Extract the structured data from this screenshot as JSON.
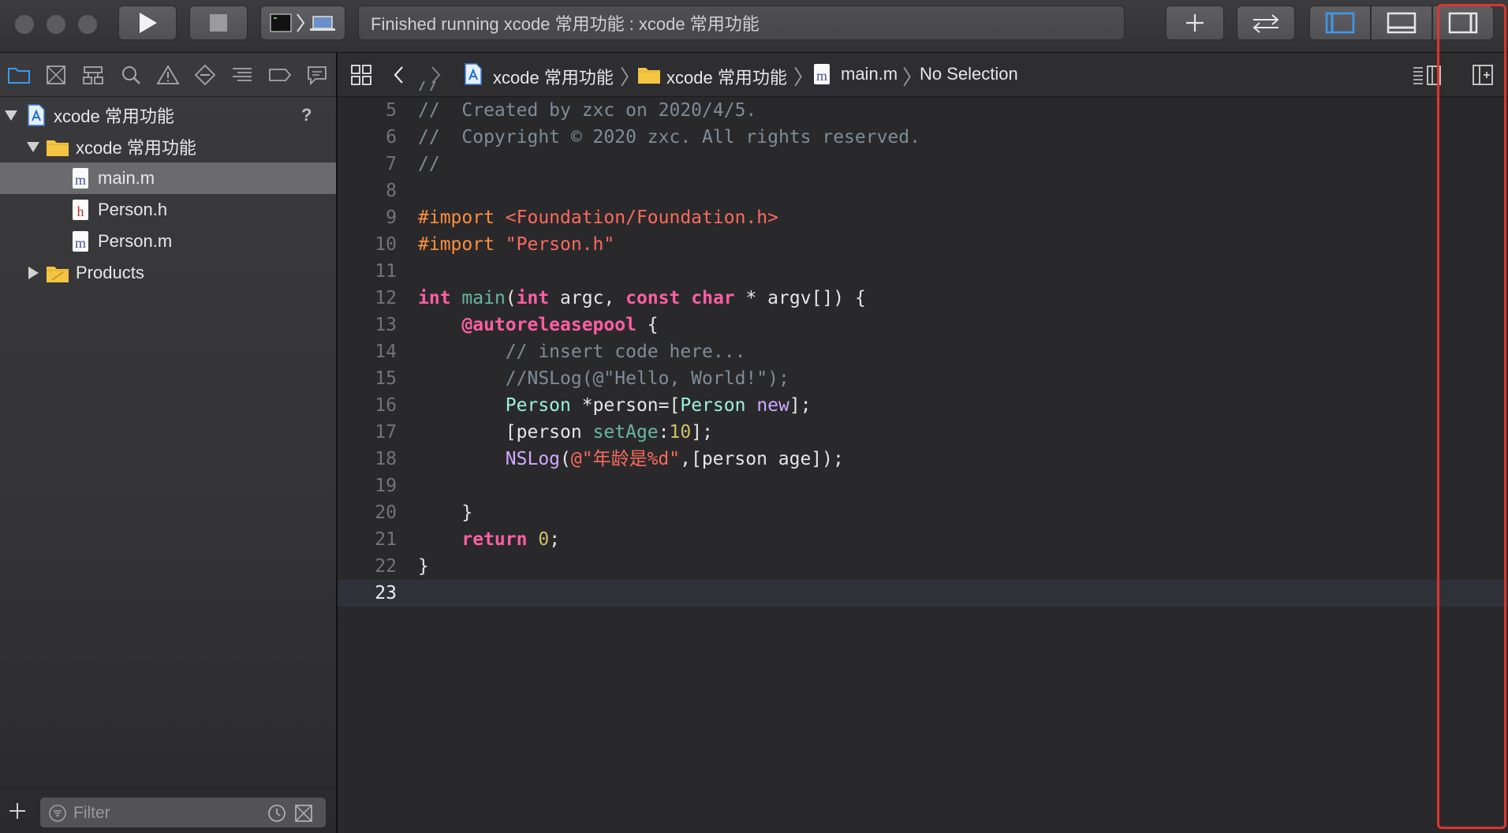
{
  "toolbar": {
    "activity_text": "Finished running xcode 常用功能 : xcode 常用功能",
    "icons": [
      "run-icon",
      "stop-icon",
      "scheme-icon",
      "add-icon",
      "swap-icon",
      "left-panel-icon",
      "bottom-panel-icon",
      "right-panel-icon"
    ]
  },
  "navigator": {
    "tabs": [
      "project-navigator-icon",
      "source-control-icon",
      "symbol-navigator-icon",
      "find-icon",
      "issue-icon",
      "test-icon",
      "debug-icon",
      "breakpoint-icon",
      "report-icon"
    ],
    "project": {
      "label": "xcode 常用功能",
      "badge": "?"
    },
    "group": {
      "label": "xcode 常用功能"
    },
    "files": [
      {
        "label": "main.m",
        "type": "m",
        "selected": true
      },
      {
        "label": "Person.h",
        "type": "h",
        "selected": false
      },
      {
        "label": "Person.m",
        "type": "m",
        "selected": false
      }
    ],
    "products": {
      "label": "Products"
    },
    "filter_placeholder": "Filter"
  },
  "jumpbar": {
    "crumbs": [
      "xcode 常用功能",
      "xcode 常用功能",
      "main.m",
      "No Selection"
    ]
  },
  "editor": {
    "current_line": 23,
    "lines": [
      {
        "n": "5",
        "tokens": [
          {
            "t": "cmt",
            "v": "//  Created by zxc on 2020/4/5."
          }
        ]
      },
      {
        "n": "6",
        "tokens": [
          {
            "t": "cmt",
            "v": "//  Copyright © 2020 zxc. All rights reserved."
          }
        ]
      },
      {
        "n": "7",
        "tokens": [
          {
            "t": "cmt",
            "v": "//"
          }
        ]
      },
      {
        "n": "8",
        "tokens": []
      },
      {
        "n": "9",
        "tokens": [
          {
            "t": "pp",
            "v": "#import "
          },
          {
            "t": "str",
            "v": "<Foundation/Foundation.h>"
          }
        ]
      },
      {
        "n": "10",
        "tokens": [
          {
            "t": "pp",
            "v": "#import "
          },
          {
            "t": "str",
            "v": "\"Person.h\""
          }
        ]
      },
      {
        "n": "11",
        "tokens": []
      },
      {
        "n": "12",
        "tokens": [
          {
            "t": "kw",
            "v": "int"
          },
          {
            "t": "",
            "v": " "
          },
          {
            "t": "fn",
            "v": "main"
          },
          {
            "t": "",
            "v": "("
          },
          {
            "t": "kw",
            "v": "int"
          },
          {
            "t": "",
            "v": " argc, "
          },
          {
            "t": "kw",
            "v": "const"
          },
          {
            "t": "",
            "v": " "
          },
          {
            "t": "kw",
            "v": "char"
          },
          {
            "t": "",
            "v": " * argv[]) {"
          }
        ]
      },
      {
        "n": "13",
        "tokens": [
          {
            "t": "",
            "v": "    "
          },
          {
            "t": "kw",
            "v": "@autoreleasepool"
          },
          {
            "t": "",
            "v": " {"
          }
        ]
      },
      {
        "n": "14",
        "tokens": [
          {
            "t": "",
            "v": "        "
          },
          {
            "t": "cmt",
            "v": "// insert code here..."
          }
        ]
      },
      {
        "n": "15",
        "tokens": [
          {
            "t": "",
            "v": "        "
          },
          {
            "t": "cmt",
            "v": "//NSLog(@\"Hello, World!\");"
          }
        ]
      },
      {
        "n": "16",
        "tokens": [
          {
            "t": "",
            "v": "        "
          },
          {
            "t": "ty2",
            "v": "Person"
          },
          {
            "t": "",
            "v": " *person=["
          },
          {
            "t": "ty2",
            "v": "Person"
          },
          {
            "t": "",
            "v": " "
          },
          {
            "t": "typ",
            "v": "new"
          },
          {
            "t": "",
            "v": "];"
          }
        ]
      },
      {
        "n": "17",
        "tokens": [
          {
            "t": "",
            "v": "        [person "
          },
          {
            "t": "fn",
            "v": "setAge"
          },
          {
            "t": "",
            "v": ":"
          },
          {
            "t": "num",
            "v": "10"
          },
          {
            "t": "",
            "v": "];"
          }
        ]
      },
      {
        "n": "18",
        "tokens": [
          {
            "t": "",
            "v": "        "
          },
          {
            "t": "typ",
            "v": "NSLog"
          },
          {
            "t": "",
            "v": "("
          },
          {
            "t": "str",
            "v": "@\"年龄是%d\""
          },
          {
            "t": "",
            "v": ",[person age]);"
          }
        ]
      },
      {
        "n": "19",
        "tokens": []
      },
      {
        "n": "20",
        "tokens": [
          {
            "t": "",
            "v": "    }"
          }
        ]
      },
      {
        "n": "21",
        "tokens": [
          {
            "t": "",
            "v": "    "
          },
          {
            "t": "kw",
            "v": "return"
          },
          {
            "t": "",
            "v": " "
          },
          {
            "t": "num",
            "v": "0"
          },
          {
            "t": "",
            "v": ";"
          }
        ]
      },
      {
        "n": "22",
        "tokens": [
          {
            "t": "",
            "v": "}"
          }
        ]
      },
      {
        "n": "23",
        "tokens": []
      }
    ]
  },
  "colors": {
    "accent": "#3b9af0",
    "highlight_box": "#e0342d",
    "keyword": "#fc5fa3",
    "string": "#fc6a5d",
    "comment": "#7f8c98"
  }
}
